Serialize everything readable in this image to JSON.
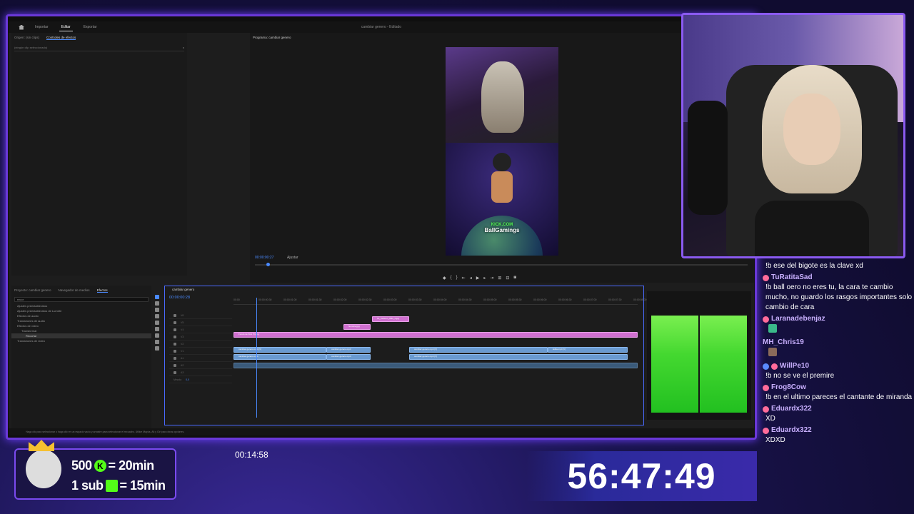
{
  "premiere": {
    "tabs": [
      "Importar",
      "Editar",
      "Exportar"
    ],
    "active_tab": "Editar",
    "project_title": "cambiar genero",
    "project_state": "Editado",
    "source_tabs": [
      "Origen: (sin clips)",
      "Controles de efectos"
    ],
    "source_dropdown": "(ningún clip seleccionado)",
    "program_label": "Programa: cambiar genero",
    "program_timecode": "00:00:00:27",
    "program_fit": "Ajustar",
    "project_tabs": [
      "Proyecto: cambiar genero",
      "Navegador de medios",
      "Efectos"
    ],
    "effects_search": "recor",
    "effects_tree": [
      "Ajustes preestablecidos",
      "Ajustes preestablecidos de Lumetri",
      "Efectos de audio",
      "Transiciones de audio",
      "Efectos de vídeo",
      "Transformar",
      "Recortar",
      "Transiciones de vídeo"
    ],
    "timeline_tab": "cambiar genero",
    "timeline_timecode": "00:00:00:28",
    "ruler_ticks": [
      "00:00",
      "00:00:00:30",
      "00:00:01:00",
      "00:00:01:30",
      "00:00:02:00",
      "00:00:02:30",
      "00:00:03:00",
      "00:00:03:30",
      "00:00:04:00",
      "00:00:04:30",
      "00:00:05:00",
      "00:00:05:30",
      "00:00:06:00",
      "00:00:06:30",
      "00:00:07:00",
      "00:00:07:30",
      "00:00:08:00"
    ],
    "tracks": [
      "V6",
      "V5",
      "V4",
      "V3",
      "V2",
      "V1",
      "A1",
      "A2",
      "A3",
      "Mezcla"
    ],
    "mix_value": "0,0",
    "clips": {
      "v6": "Gt_Cartoon_IMG_2.jpg",
      "v5": "Nombre.jpg",
      "v4": "Fondo de Kick (5).jpg",
      "v2a": "cambiar genero.mp4 [V]",
      "v2b": "cambiar genero.mp4",
      "v2c": "cambiar genero.mp4 [V]",
      "v2d": "Edita.mp4 [V]",
      "v1a": "cambiar genero.mp4",
      "v1b": "cambiar genero.mp4",
      "v1c": "cambiar genero.mp4 [V]"
    },
    "status_text": "Haga clic para seleccionar o haga clic en un espacio vacío y arrastre para seleccionar el recuadro. Utilice Mayús, Alt y Ctrl para otras opciones.",
    "video_overlay": {
      "kick": "KICK.COM",
      "name": "BallGamings"
    }
  },
  "chat": [
    {
      "user": "",
      "text": "!b ese del bigote es la clave xd"
    },
    {
      "user": "TuRatitaSad",
      "text": "!b ball oero no eres tu, la cara te cambio mucho, no guardo los rasgos importantes solo cambio de cara"
    },
    {
      "user": "Laranadebenjaz",
      "text": ""
    },
    {
      "user": "MH_Chris19",
      "text": ""
    },
    {
      "user": "WillPe10",
      "text": "!b no se ve el premire"
    },
    {
      "user": "Frog8Cow",
      "text": "!b en el ultimo pareces el cantante de miranda"
    },
    {
      "user": "Eduardx322",
      "text": "XD"
    },
    {
      "user": "Eduardx322",
      "text": "XDXD"
    }
  ],
  "promo": {
    "line1_num": "500",
    "line1_eq": "= 20min",
    "line2_num": "1 sub",
    "line2_eq": "= 15min",
    "k_label": "K"
  },
  "elapsed": "00:14:58",
  "countdown": "56:47:49",
  "colors": {
    "accent": "#7a4aef",
    "kick_green": "#53fc18",
    "premiere_blue": "#4a8aff"
  }
}
